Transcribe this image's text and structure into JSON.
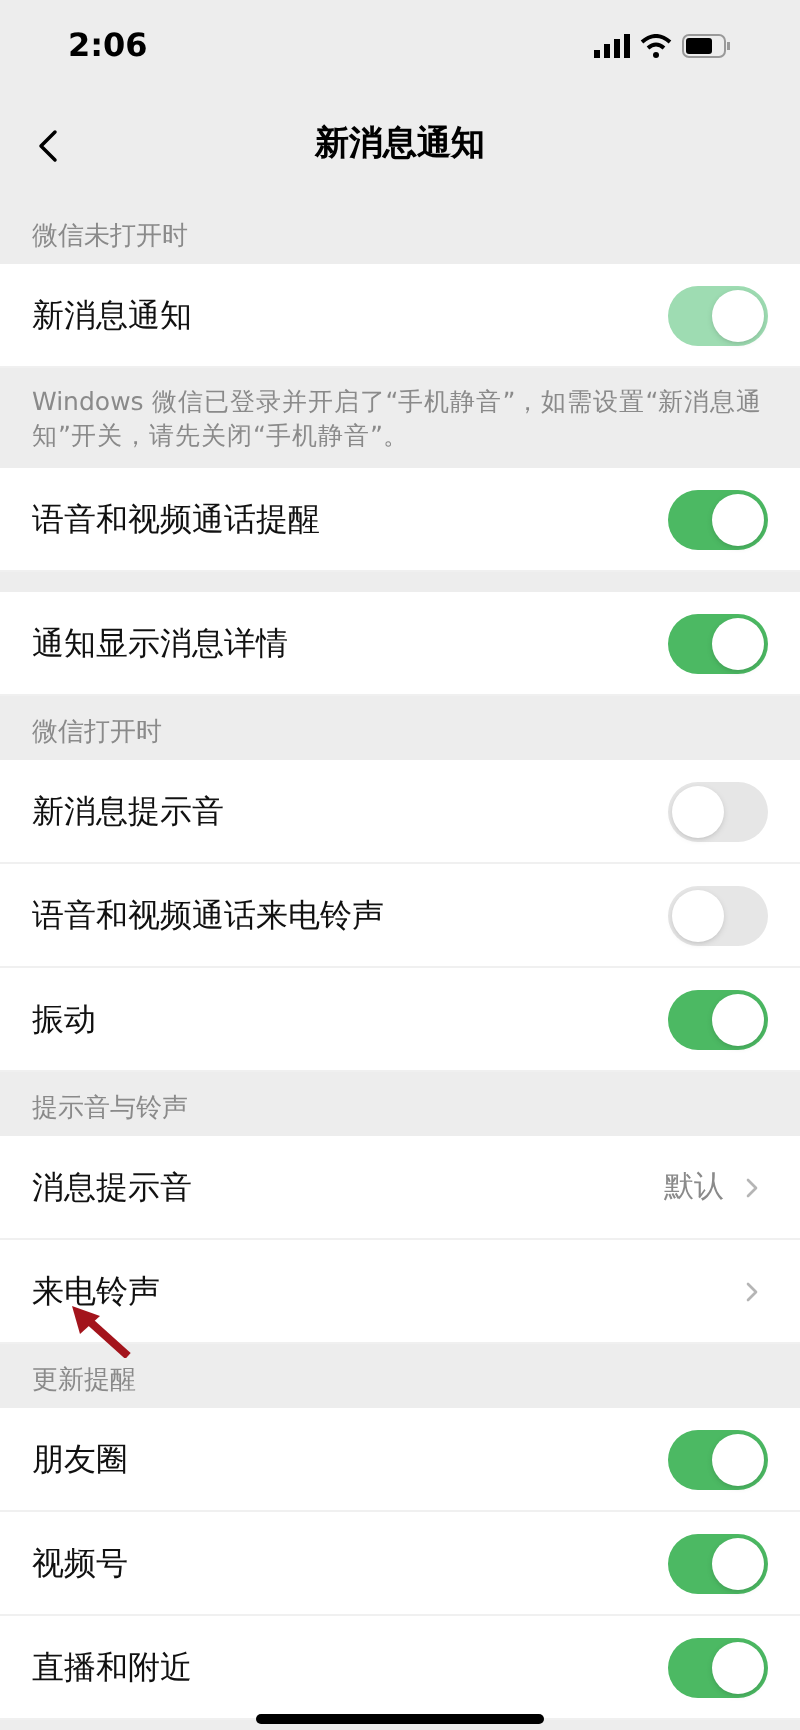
{
  "status_bar": {
    "time": "2:06"
  },
  "nav": {
    "title": "新消息通知"
  },
  "sections": [
    {
      "header": "微信未打开时",
      "items": [
        {
          "kind": "toggle",
          "label": "新消息通知",
          "on": true,
          "disabled": true,
          "gap_before": false
        },
        {
          "kind": "note",
          "text": "Windows 微信已登录并开启了“手机静音”，如需设置“新消息通知”开关，请先关闭“手机静音”。",
          "gap_before": false
        },
        {
          "kind": "toggle",
          "label": "语音和视频通话提醒",
          "on": true,
          "disabled": false,
          "gap_before": false
        },
        {
          "kind": "toggle",
          "label": "通知显示消息详情",
          "on": true,
          "disabled": false,
          "gap_before": true
        }
      ]
    },
    {
      "header": "微信打开时",
      "items": [
        {
          "kind": "toggle",
          "label": "新消息提示音",
          "on": false,
          "disabled": false,
          "gap_before": false
        },
        {
          "kind": "toggle",
          "label": "语音和视频通话来电铃声",
          "on": false,
          "disabled": false,
          "gap_before": false
        },
        {
          "kind": "toggle",
          "label": "振动",
          "on": true,
          "disabled": false,
          "gap_before": false
        }
      ]
    },
    {
      "header": "提示音与铃声",
      "items": [
        {
          "kind": "link",
          "label": "消息提示音",
          "value": "默认",
          "gap_before": false
        },
        {
          "kind": "link",
          "label": "来电铃声",
          "gap_before": false
        }
      ]
    },
    {
      "header": "更新提醒",
      "items": [
        {
          "kind": "toggle",
          "label": "朋友圈",
          "on": true,
          "disabled": false,
          "gap_before": false
        },
        {
          "kind": "toggle",
          "label": "视频号",
          "on": true,
          "disabled": false,
          "gap_before": false
        },
        {
          "kind": "toggle",
          "label": "直播和附近",
          "on": true,
          "disabled": false,
          "gap_before": false
        }
      ]
    }
  ]
}
